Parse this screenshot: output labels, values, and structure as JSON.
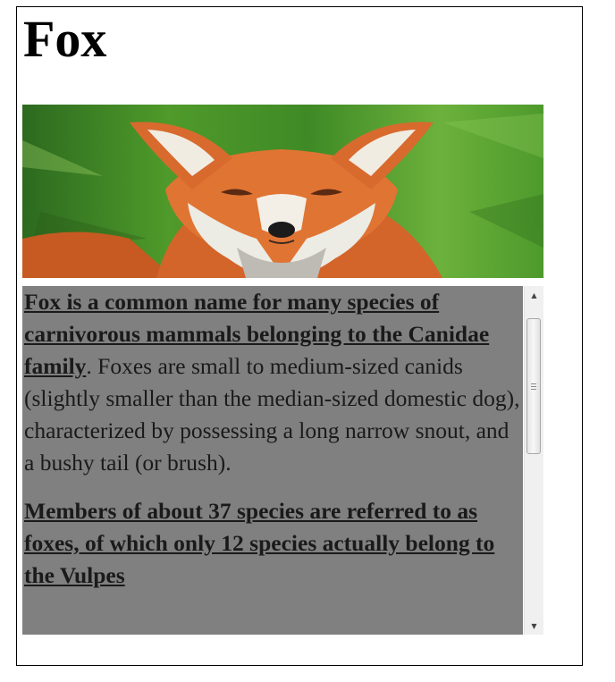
{
  "page": {
    "title": "Fox"
  },
  "hero_image": {
    "subject": "red fox portrait",
    "colors": {
      "grass": "#4f9a2a",
      "fur": "#d9622a",
      "white_fur": "#ecebe4"
    }
  },
  "article": {
    "paragraphs": [
      {
        "lead": "Fox is a common name for many species of carnivorous mammals belonging to the Canidae family",
        "body": ". Foxes are small to medium-sized canids (slightly smaller than the median-sized domestic dog), characterized by possessing a long narrow snout, and a bushy tail (or brush)."
      },
      {
        "lead": "Members of about 37 species are referred to as foxes, of which only 12 species actually belong to the Vulpes",
        "body": ""
      }
    ]
  },
  "scrollbar": {
    "up_icon": "arrow-up-icon",
    "down_icon": "arrow-down-icon",
    "position": 0.0
  },
  "colors": {
    "text_area_bg": "#808080",
    "text": "#1a1a1a",
    "border": "#000000"
  }
}
